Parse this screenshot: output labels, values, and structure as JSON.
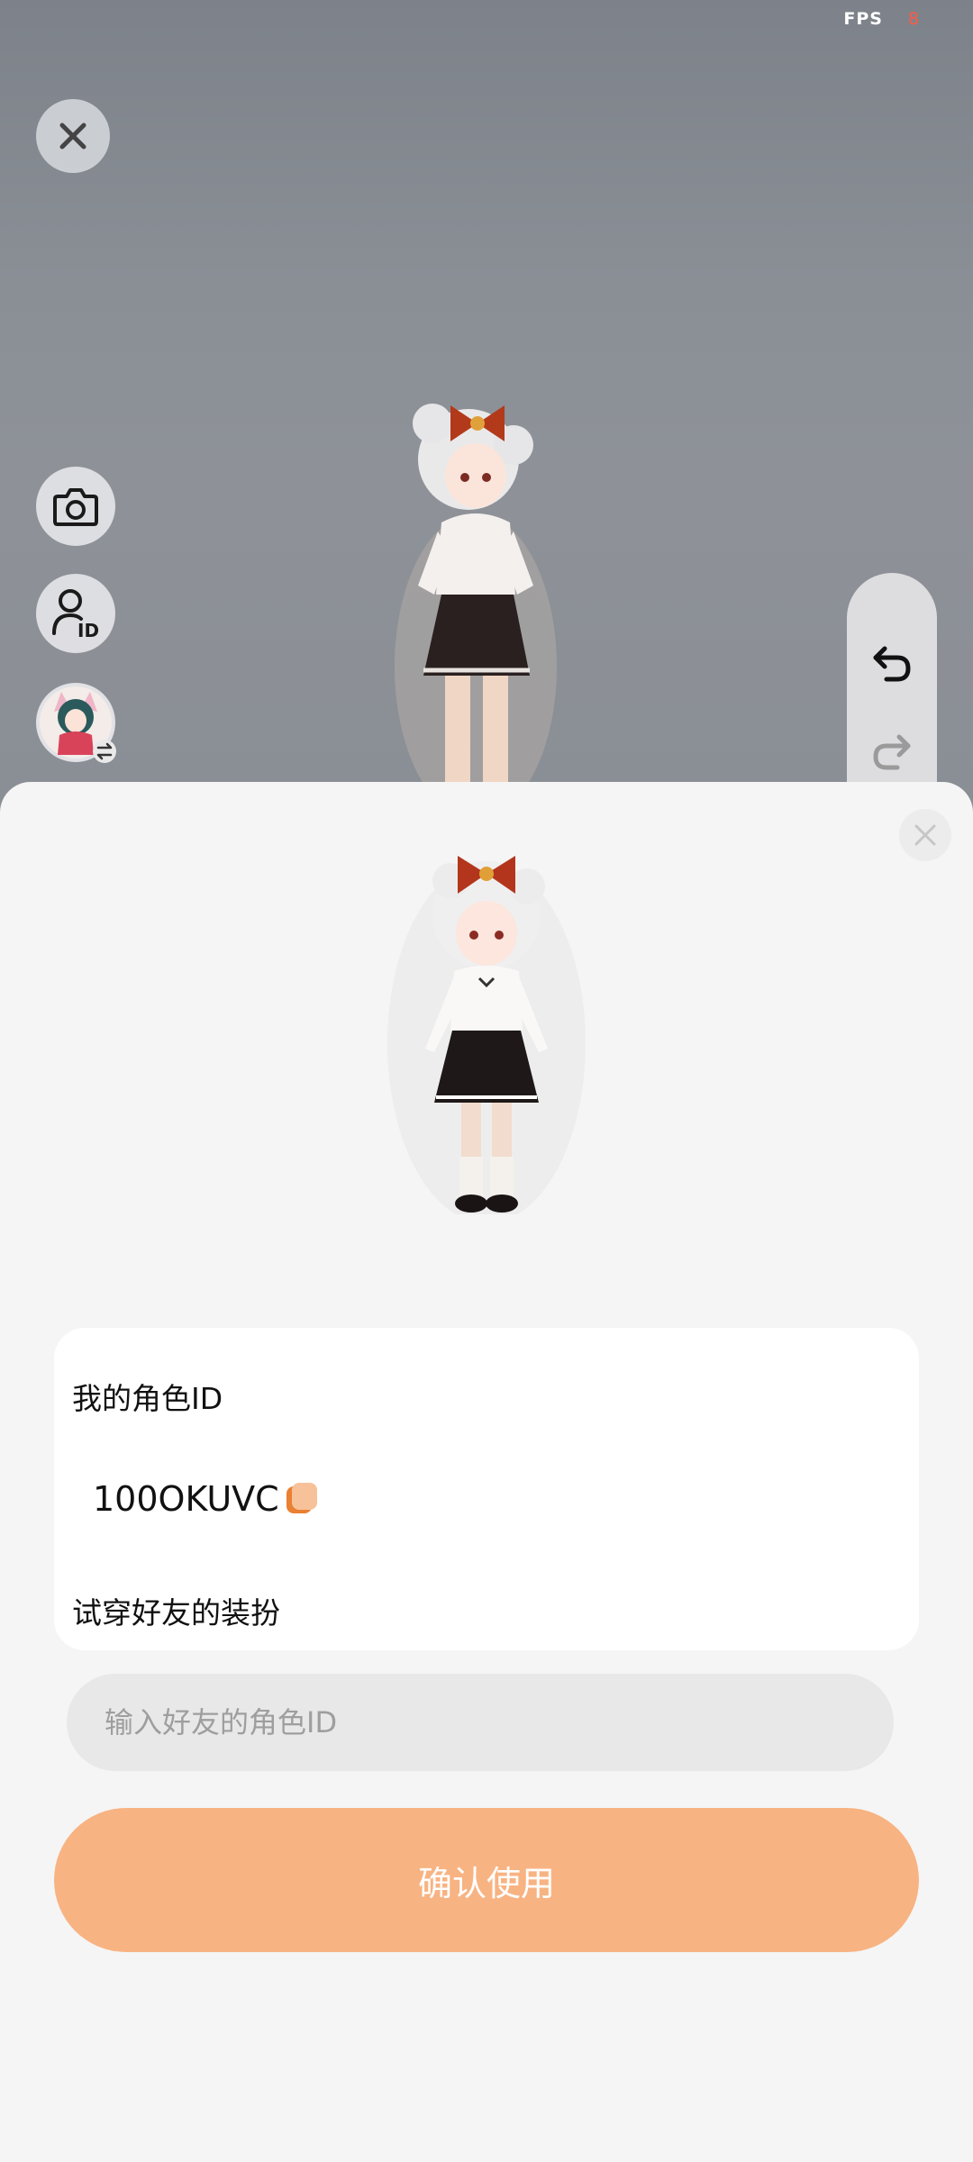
{
  "status": {
    "fps_label": "FPS",
    "fps_value": "8"
  },
  "viewport_controls": {
    "close_icon": "close-icon",
    "camera_icon": "camera-icon",
    "character_id_icon": "user-id-icon",
    "avatar_switch_icon": "swap-icon",
    "undo_icon": "undo-icon",
    "redo_icon": "redo-icon"
  },
  "sheet": {
    "my_id_label": "我的角色ID",
    "my_id_value": "100OKUVC",
    "try_on_label": "试穿好友的装扮",
    "friend_input_placeholder": "输入好友的角色ID",
    "friend_input_value": "",
    "confirm_label": "确认使用"
  },
  "colors": {
    "accent": "#f8b383",
    "copy_icon": "#e98032",
    "fps_value": "#ff5a44"
  }
}
